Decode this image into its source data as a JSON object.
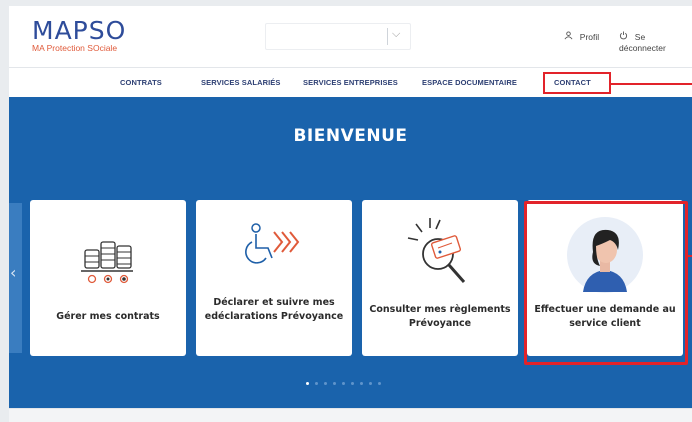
{
  "logo": {
    "main": "MAPSO",
    "sub_part1": "MA Protection ",
    "sub_part2": "SO",
    "sub_part3": "ciale"
  },
  "header": {
    "select_value": "",
    "profile_label": "Profil",
    "logout_label": "Se déconnecter"
  },
  "nav": {
    "items": [
      {
        "label": "CONTRATS"
      },
      {
        "label": "SERVICES SALARIÉS"
      },
      {
        "label": "SERVICES ENTREPRISES"
      },
      {
        "label": "ESPACE DOCUMENTAIRE"
      },
      {
        "label": "CONTACT"
      }
    ]
  },
  "hero": {
    "title": "BIENVENUE"
  },
  "cards": [
    {
      "label": "Gérer mes contrats",
      "icon": "coins-icon"
    },
    {
      "label": "Déclarer et suivre mes edéclarations Prévoyance",
      "icon": "wheelchair-icon"
    },
    {
      "label": "Consulter mes règlements Prévoyance",
      "icon": "magnifier-card-icon"
    },
    {
      "label": "Effectuer une demande au service client",
      "icon": "customer-service-icon"
    }
  ],
  "carousel": {
    "slides": 9,
    "active_index": 0
  },
  "colors": {
    "brand_blue": "#1a63ac",
    "nav_text": "#2d3f73",
    "highlight_red": "#e2232a",
    "accent_orange": "#e05a3a"
  }
}
